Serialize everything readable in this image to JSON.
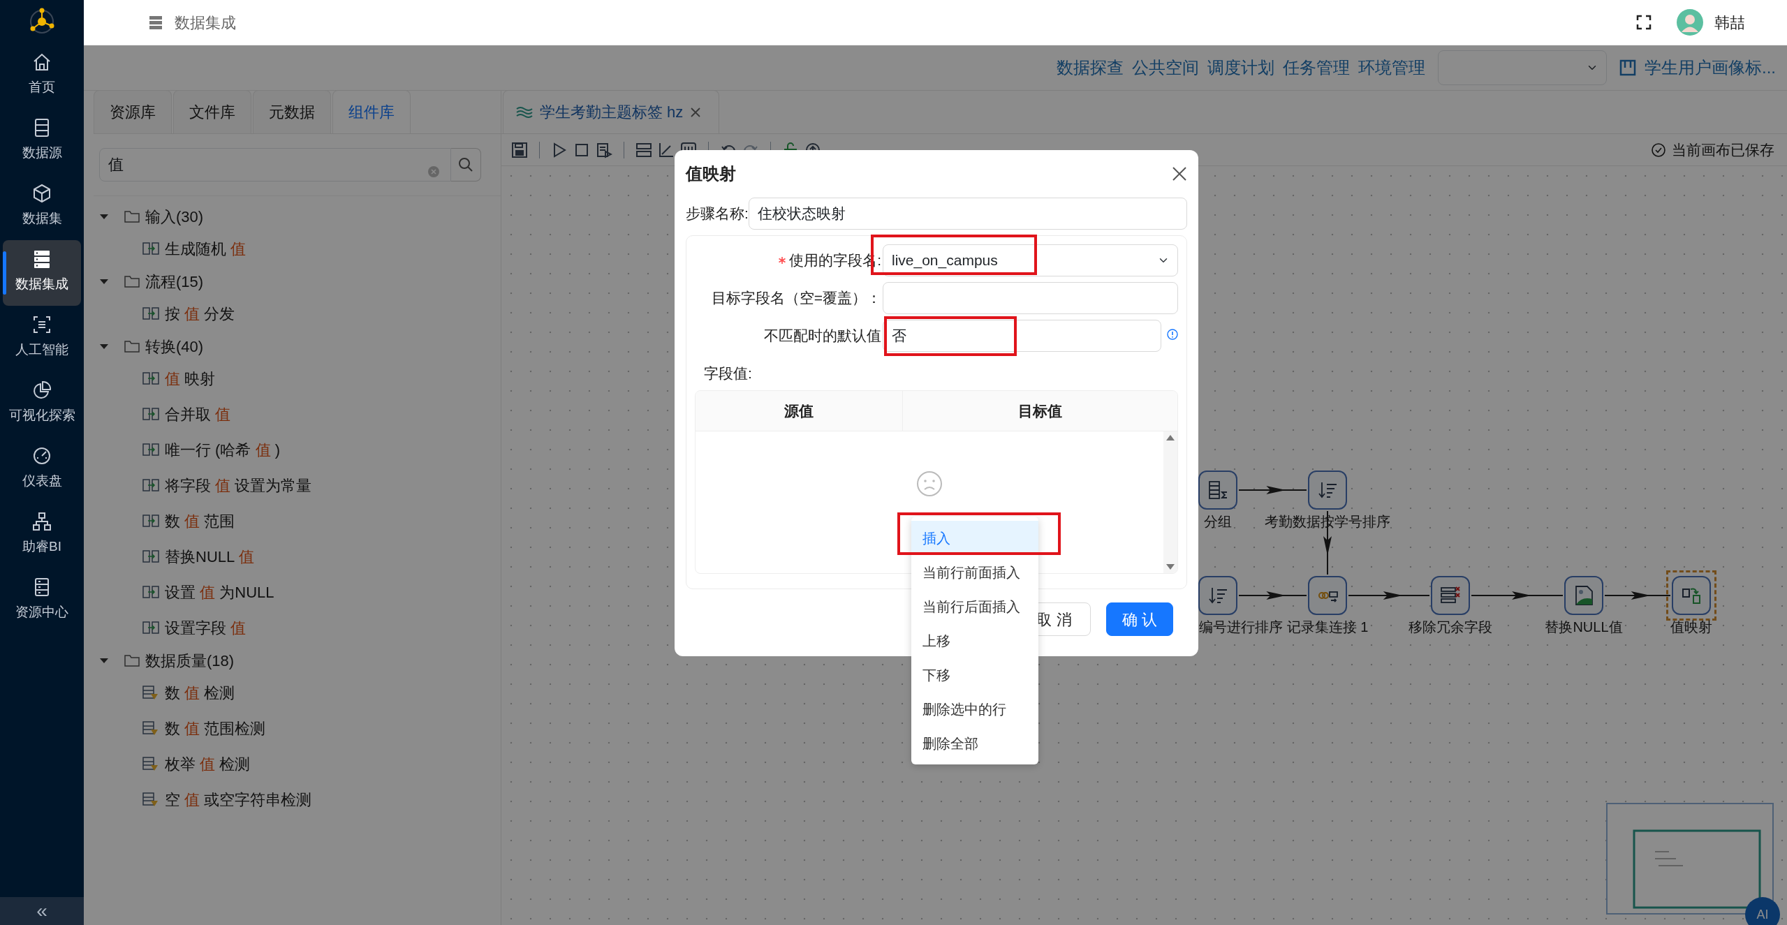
{
  "sidebar": {
    "items": [
      {
        "label": "首页",
        "selected": false
      },
      {
        "label": "数据源",
        "selected": false
      },
      {
        "label": "数据集",
        "selected": false
      },
      {
        "label": "数据集成",
        "selected": true
      },
      {
        "label": "人工智能",
        "selected": false
      },
      {
        "label": "可视化探索",
        "selected": false
      },
      {
        "label": "仪表盘",
        "selected": false
      },
      {
        "label": "助睿BI",
        "selected": false
      },
      {
        "label": "资源中心",
        "selected": false
      }
    ],
    "collapse": "«"
  },
  "header": {
    "breadcrumb": "数据集成",
    "user": "韩喆"
  },
  "top_nav": {
    "links": [
      "数据探查",
      "公共空间",
      "调度计划",
      "任务管理",
      "环境管理"
    ],
    "project": "学生用户画像标..."
  },
  "left_panel": {
    "tabs": [
      {
        "label": "资源库",
        "selected": false
      },
      {
        "label": "文件库",
        "selected": false
      },
      {
        "label": "元数据",
        "selected": false
      },
      {
        "label": "组件库",
        "selected": true
      }
    ],
    "search": {
      "value": "值"
    },
    "tree": [
      {
        "label": "输入(30)",
        "expanded": true,
        "children": [
          {
            "segments": [
              {
                "text": "生成随机 ",
                "highlight": false
              },
              {
                "text": "值",
                "highlight": true
              }
            ]
          }
        ]
      },
      {
        "label": "流程(15)",
        "expanded": true,
        "children": [
          {
            "segments": [
              {
                "text": "按 ",
                "highlight": false
              },
              {
                "text": "值",
                "highlight": true
              },
              {
                "text": " 分发",
                "highlight": false
              }
            ]
          }
        ]
      },
      {
        "label": "转换(40)",
        "expanded": true,
        "children": [
          {
            "segments": [
              {
                "text": "值",
                "highlight": true
              },
              {
                "text": " 映射",
                "highlight": false
              }
            ]
          },
          {
            "segments": [
              {
                "text": "合并取 ",
                "highlight": false
              },
              {
                "text": "值",
                "highlight": true
              }
            ]
          },
          {
            "segments": [
              {
                "text": "唯一行 (哈希 ",
                "highlight": false
              },
              {
                "text": "值",
                "highlight": true
              },
              {
                "text": " )",
                "highlight": false
              }
            ]
          },
          {
            "segments": [
              {
                "text": "将字段 ",
                "highlight": false
              },
              {
                "text": "值",
                "highlight": true
              },
              {
                "text": " 设置为常量",
                "highlight": false
              }
            ]
          },
          {
            "segments": [
              {
                "text": "数 ",
                "highlight": false
              },
              {
                "text": "值",
                "highlight": true
              },
              {
                "text": " 范围",
                "highlight": false
              }
            ]
          },
          {
            "segments": [
              {
                "text": "替换NULL ",
                "highlight": false
              },
              {
                "text": "值",
                "highlight": true
              }
            ]
          },
          {
            "segments": [
              {
                "text": "设置 ",
                "highlight": false
              },
              {
                "text": "值",
                "highlight": true
              },
              {
                "text": " 为NULL",
                "highlight": false
              }
            ]
          },
          {
            "segments": [
              {
                "text": "设置字段 ",
                "highlight": false
              },
              {
                "text": "值",
                "highlight": true
              }
            ]
          }
        ]
      },
      {
        "label": "数据质量(18)",
        "expanded": true,
        "children": [
          {
            "segments": [
              {
                "text": "数 ",
                "highlight": false
              },
              {
                "text": "值",
                "highlight": true
              },
              {
                "text": " 检测",
                "highlight": false
              }
            ]
          },
          {
            "segments": [
              {
                "text": "数 ",
                "highlight": false
              },
              {
                "text": "值",
                "highlight": true
              },
              {
                "text": " 范围检测",
                "highlight": false
              }
            ]
          },
          {
            "segments": [
              {
                "text": "枚举 ",
                "highlight": false
              },
              {
                "text": "值",
                "highlight": true
              },
              {
                "text": " 检测",
                "highlight": false
              }
            ]
          },
          {
            "segments": [
              {
                "text": "空 ",
                "highlight": false
              },
              {
                "text": "值",
                "highlight": true
              },
              {
                "text": " 或空字符串检测",
                "highlight": false
              }
            ]
          }
        ]
      }
    ]
  },
  "editor": {
    "tab": "学生考勤主题标签 hz",
    "status": "当前画布已保存",
    "canvas": {
      "nodes": [
        {
          "label": "分组",
          "selected": false
        },
        {
          "label": "考勤数据按学号排序",
          "selected": false
        },
        {
          "label": "编号进行排序",
          "selected": false
        },
        {
          "label": "记录集连接 1",
          "selected": false
        },
        {
          "label": "移除冗余字段",
          "selected": false
        },
        {
          "label": "替换NULL值",
          "selected": false
        },
        {
          "label": "值映射",
          "selected": true
        }
      ]
    }
  },
  "dialog": {
    "title": "值映射",
    "step": {
      "label": "步骤名称:",
      "value": "住校状态映射"
    },
    "fields": [
      {
        "label": "使用的字段名:",
        "kind": "select",
        "value": "live_on_campus",
        "required": true,
        "info": false
      },
      {
        "label": "目标字段名（空=覆盖）：",
        "kind": "input",
        "required": false,
        "info": false
      },
      {
        "label": "不匹配时的默认值",
        "kind": "input",
        "value": "否",
        "required": false,
        "info": true
      }
    ],
    "section": "字段值:",
    "table": {
      "columns": [
        "源值",
        "目标值"
      ]
    },
    "menu": [
      {
        "label": "插入",
        "selected": true
      },
      {
        "label": "当前行前面插入",
        "selected": false
      },
      {
        "label": "当前行后面插入",
        "selected": false
      },
      {
        "label": "上移",
        "selected": false
      },
      {
        "label": "下移",
        "selected": false
      },
      {
        "label": "删除选中的行",
        "selected": false
      },
      {
        "label": "删除全部",
        "selected": false
      }
    ],
    "buttons": [
      {
        "label": "取 消",
        "kind": "cancel"
      },
      {
        "label": "确 认",
        "kind": "primary"
      }
    ]
  },
  "ai_button": "AI"
}
